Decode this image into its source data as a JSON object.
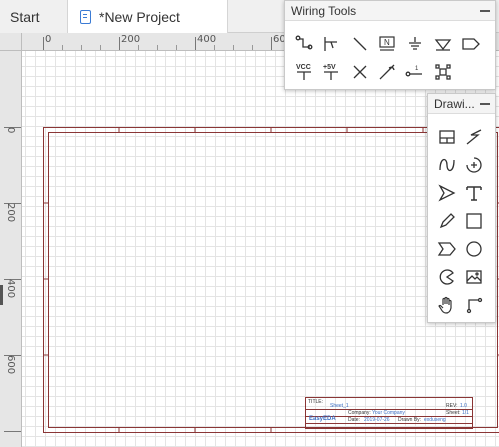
{
  "tabs": {
    "start_label": "Start",
    "project_label": "*New Project"
  },
  "rulers": {
    "top_labels": [
      "0",
      "200",
      "400",
      "60"
    ],
    "left_labels": [
      "0",
      "200",
      "400",
      "600"
    ]
  },
  "wiring_tools": {
    "title": "Wiring Tools",
    "tools": [
      "wire",
      "bus",
      "bus-entry",
      "net-label",
      "net-port",
      "ground",
      "net-flag",
      "vcc",
      "+5v",
      "no-connect",
      "pin",
      "voltage-probe",
      "group"
    ],
    "vcc_label": "VCC",
    "plus5v_label": "+5V",
    "netlabel_text": "N",
    "pin_text": "1"
  },
  "drawing_tools": {
    "title": "Drawi...",
    "tools": [
      "table",
      "line",
      "bezier",
      "arc",
      "arrow",
      "text",
      "freehand",
      "rectangle",
      "polygon",
      "circle",
      "pie",
      "image",
      "drag",
      "connector"
    ]
  },
  "title_block": {
    "title_label": "TITLE:",
    "title_value": "Sheet_1",
    "rev_label": "REV:",
    "rev_value": "1.0",
    "company_label": "Company:",
    "company_value": "Your Company",
    "sheet_label": "Sheet:",
    "sheet_value": "1/1",
    "date_label": "Date:",
    "date_value": "2019-07-26",
    "drawn_label": "Drawn By:",
    "drawn_value": "exduseng",
    "logo_text": "EasyEDA"
  },
  "colors": {
    "sheet_border": "#8a3535",
    "grid": "#e4e4e4",
    "accent": "#3b6fc4"
  }
}
